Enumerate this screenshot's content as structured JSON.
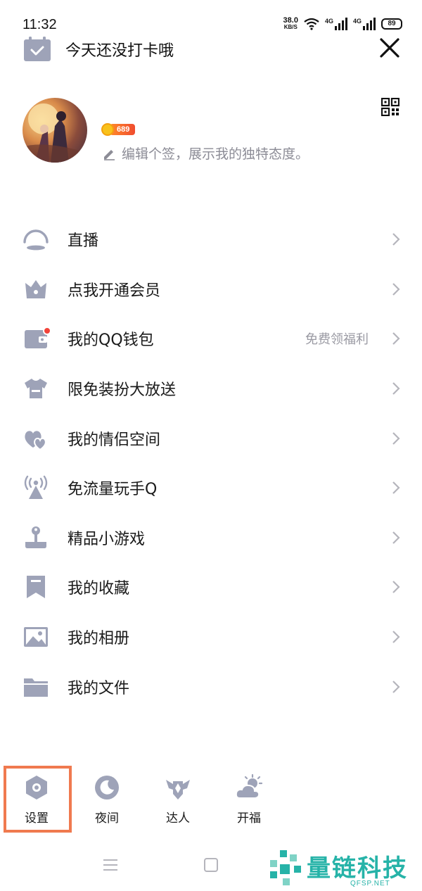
{
  "status_bar": {
    "time": "11:32",
    "net_speed": "38.0",
    "net_unit": "KB/S",
    "sim1": "4G",
    "sim2": "4G",
    "battery": "89"
  },
  "header": {
    "checkin_text": "今天还没打卡哦",
    "icons": {
      "checkin": "calendar-check-icon",
      "close": "close-icon",
      "qr": "qr-code-icon"
    }
  },
  "profile": {
    "level": "689",
    "signature_placeholder": "编辑个签，展示我的独特态度。"
  },
  "menu": [
    {
      "label": "直播",
      "icon": "live-icon",
      "extra": ""
    },
    {
      "label": "点我开通会员",
      "icon": "crown-icon",
      "extra": ""
    },
    {
      "label": "我的QQ钱包",
      "icon": "wallet-icon",
      "extra": "免费领福利",
      "has_dot": true
    },
    {
      "label": "限免装扮大放送",
      "icon": "tshirt-icon",
      "extra": ""
    },
    {
      "label": "我的情侣空间",
      "icon": "hearts-icon",
      "extra": ""
    },
    {
      "label": "免流量玩手Q",
      "icon": "signal-tower-icon",
      "extra": ""
    },
    {
      "label": "精品小游戏",
      "icon": "joystick-icon",
      "extra": ""
    },
    {
      "label": "我的收藏",
      "icon": "bookmark-icon",
      "extra": ""
    },
    {
      "label": "我的相册",
      "icon": "photo-icon",
      "extra": ""
    },
    {
      "label": "我的文件",
      "icon": "folder-icon",
      "extra": ""
    }
  ],
  "dock": [
    {
      "label": "设置",
      "icon": "settings-icon"
    },
    {
      "label": "夜间",
      "icon": "moon-icon"
    },
    {
      "label": "达人",
      "icon": "badge-icon"
    },
    {
      "label": "开福",
      "icon": "weather-icon"
    }
  ],
  "watermark": {
    "text": "量链科技",
    "sub": "QFSP.NET"
  },
  "colors": {
    "icon_gray": "#9ea3b8",
    "accent_orange": "#f07a4f",
    "badge_red": "#f2433a",
    "watermark": "#26b3a8"
  }
}
